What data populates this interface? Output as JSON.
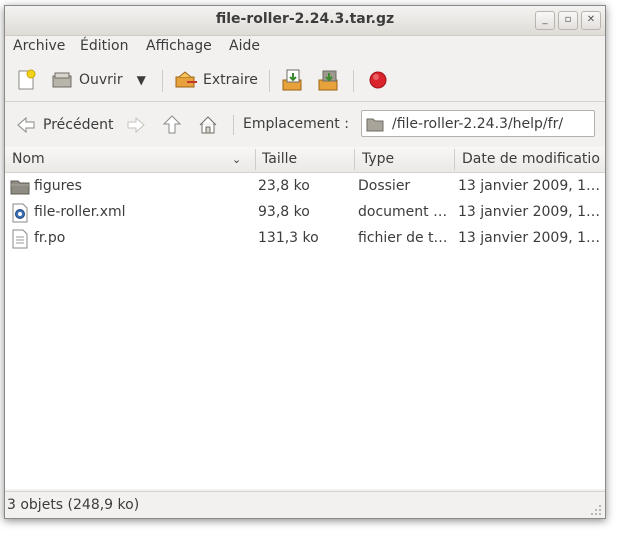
{
  "window": {
    "title": "file-roller-2.24.3.tar.gz"
  },
  "menu": [
    "Archive",
    "Édition",
    "Affichage",
    "Aide"
  ],
  "toolbar": {
    "open_label": "Ouvrir",
    "extract_label": "Extraire"
  },
  "location": {
    "back_label": "Précédent",
    "label": "Emplacement :",
    "path": "/file-roller-2.24.3/help/fr/"
  },
  "columns": [
    "Nom",
    "Taille",
    "Type",
    "Date de modificatio"
  ],
  "files": [
    {
      "name": "figures",
      "size": "23,8 ko",
      "type": "Dossier",
      "date": "13 janvier 2009, 11…",
      "icon": "folder-icon"
    },
    {
      "name": "file-roller.xml",
      "size": "93,8 ko",
      "type": "document …",
      "date": "13 janvier 2009, 11…",
      "icon": "xml-file-icon"
    },
    {
      "name": "fr.po",
      "size": "131,3 ko",
      "type": "fichier de t…",
      "date": "13 janvier 2009, 11…",
      "icon": "text-file-icon"
    }
  ],
  "status": "3 objets (248,9 ko)",
  "colors": {
    "window_bg": "#f2f1f0",
    "stop_red": "#d9242b",
    "folder": "#8f8c84"
  }
}
